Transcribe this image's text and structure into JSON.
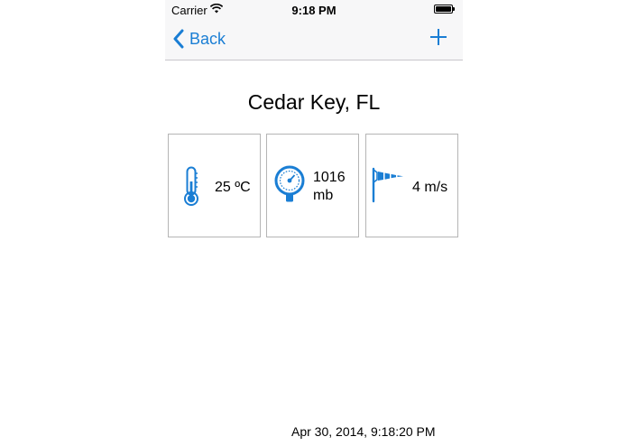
{
  "status_bar": {
    "carrier": "Carrier",
    "time": "9:18 PM"
  },
  "nav": {
    "back_label": "Back",
    "add_icon": "plus-icon",
    "back_icon": "chevron-left-icon"
  },
  "location": {
    "name": "Cedar Key, FL"
  },
  "weather": {
    "temperature": "25 ºC",
    "pressure_value": "1016",
    "pressure_unit": "mb",
    "wind": "4 m/s"
  },
  "icons": {
    "temperature": "thermometer-icon",
    "pressure": "barometer-icon",
    "wind": "windsock-icon"
  },
  "timestamp": "Apr 30, 2014, 9:18:20 PM",
  "colors": {
    "accent": "#1a7ed4",
    "tile_border": "#b5b5b5",
    "nav_background": "#f7f7f8"
  }
}
